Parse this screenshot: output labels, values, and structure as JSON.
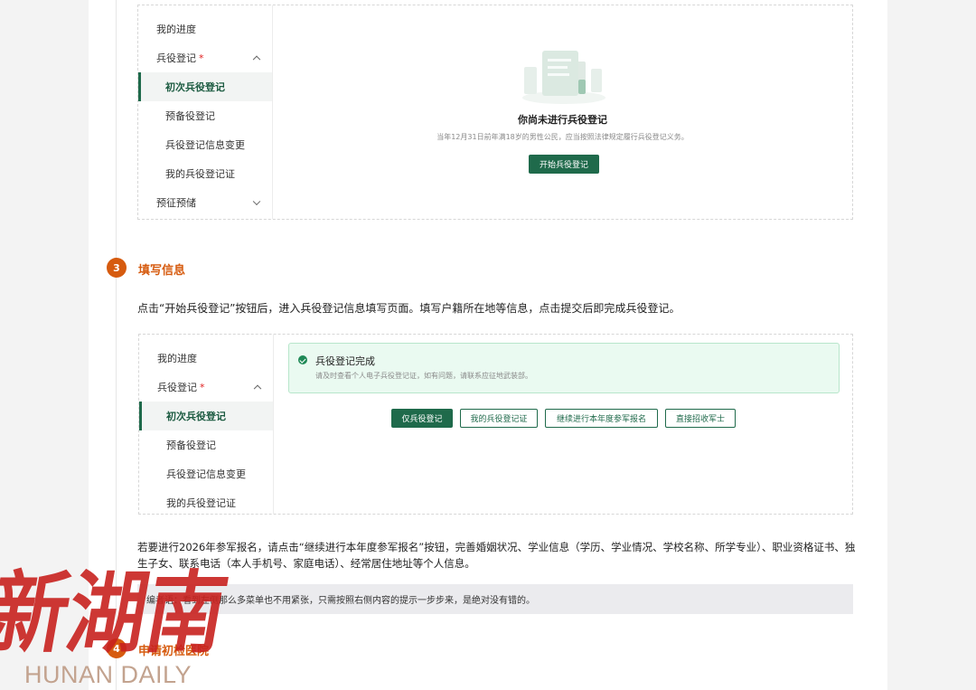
{
  "screenshot1": {
    "sidebar": {
      "my_progress": "我的进度",
      "registration": "兵役登记",
      "required_mark": "*",
      "first_registration": "初次兵役登记",
      "reserve_registration": "预备役登记",
      "info_change": "兵役登记信息变更",
      "my_certificate": "我的兵役登记证",
      "pre_enlistment": "预征预储"
    },
    "empty_title": "你尚未进行兵役登记",
    "empty_desc": "当年12月31日前年满18岁的男性公民，应当按照法律规定履行兵役登记义务。",
    "start_button": "开始兵役登记"
  },
  "step3": {
    "number": "3",
    "title": "填写信息",
    "paragraph": "点击“开始兵役登记”按钮后，进入兵役登记信息填写页面。填写户籍所在地等信息，点击提交后即完成兵役登记。"
  },
  "screenshot2": {
    "sidebar": {
      "my_progress": "我的进度",
      "registration": "兵役登记",
      "required_mark": "*",
      "first_registration": "初次兵役登记",
      "reserve_registration": "预备役登记",
      "info_change": "兵役登记信息变更",
      "my_certificate": "我的兵役登记证"
    },
    "success_title": "兵役登记完成",
    "success_desc": "请及时查看个人电子兵役登记证，如有问题，请联系应征地武装部。",
    "buttons": {
      "only_register": "仅兵役登记",
      "my_certificate": "我的兵役登记证",
      "continue_apply": "继续进行本年度参军报名",
      "direct_recruit": "直接招收军士"
    }
  },
  "paragraph2": "若要进行2026年参军报名，请点击“继续进行本年度参军报名”按钮，完善婚姻状况、学业信息（学历、学业情况、学校名称、所学专业）、职业资格证书、独生子女、联系电话（本人手机号、家庭电话）、经常居住地址等个人信息。",
  "note": "编者语：看到左侧那么多菜单也不用紧张，只需按照右侧内容的提示一步步来，是绝对没有错的。",
  "step4": {
    "number": "4",
    "title": "申请初检医院"
  },
  "watermark": {
    "cn": "新湖南",
    "en": "HUNAN DAILY"
  },
  "colors": {
    "brand_green": "#1f6a4b",
    "step_orange": "#d65b0f",
    "watermark_red": "#c8211e"
  }
}
